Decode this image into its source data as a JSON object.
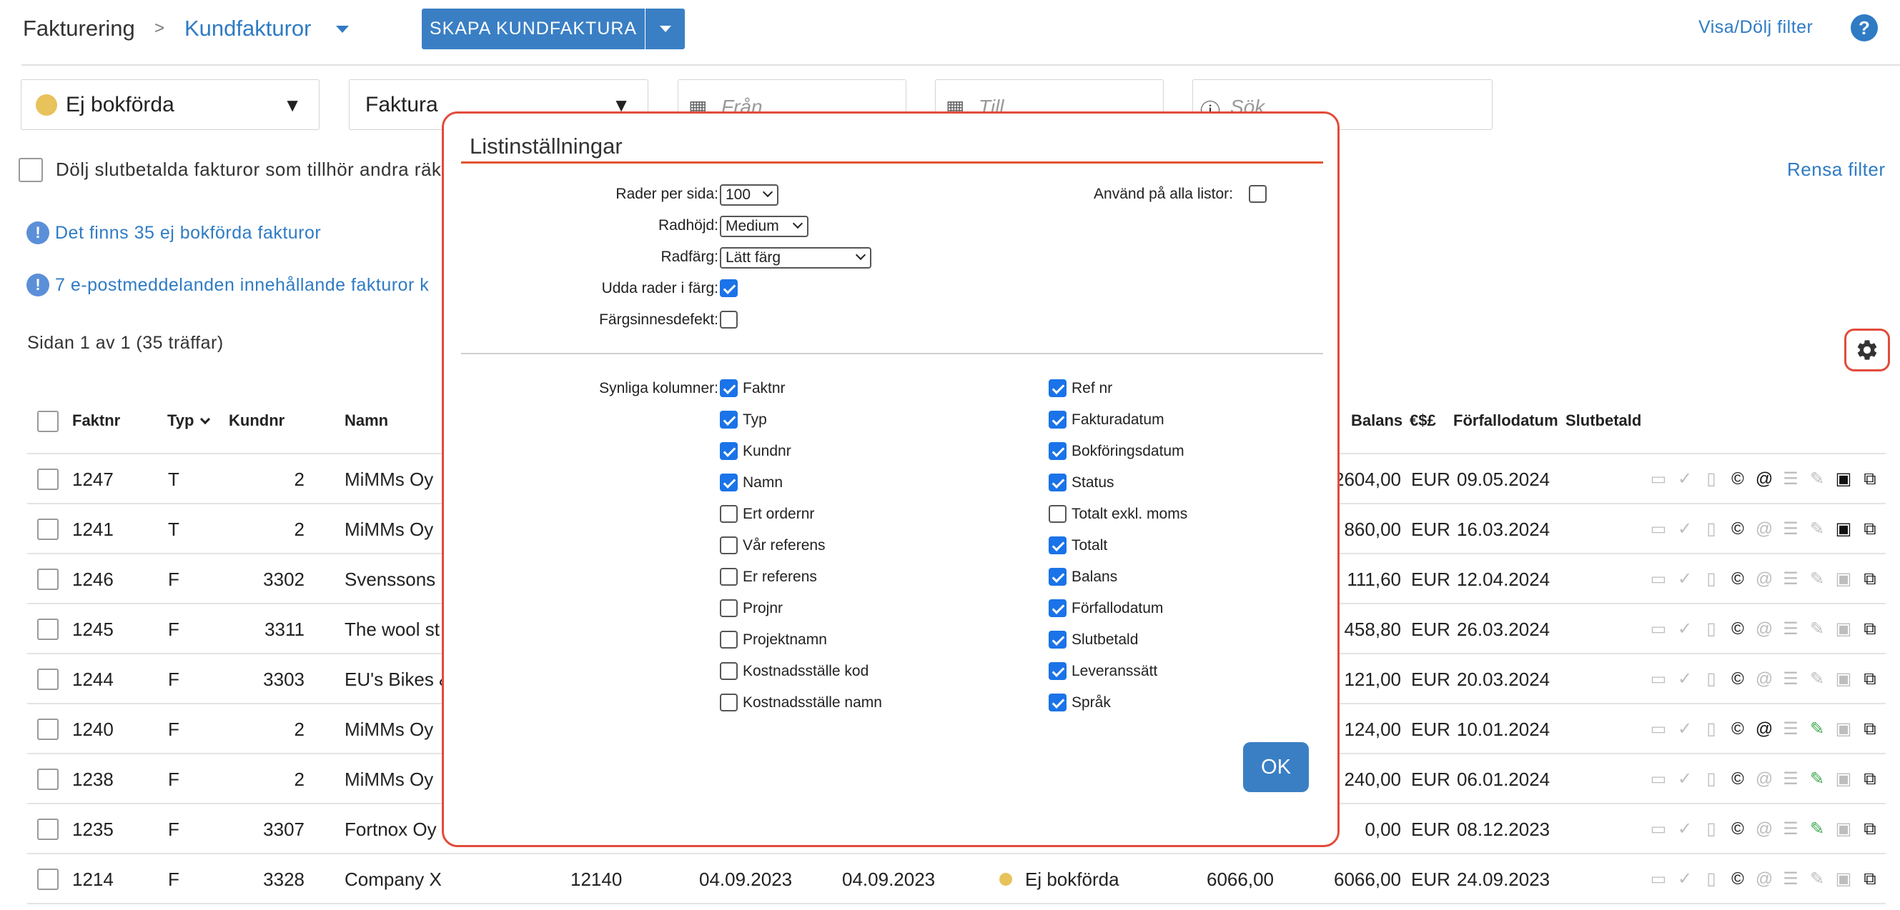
{
  "breadcrumb": {
    "root": "Fakturering",
    "sep": ">",
    "current": "Kundfakturor"
  },
  "toolbar": {
    "create_label": "SKAPA KUNDFAKTURA",
    "toggle_filter": "Visa/Dölj filter",
    "help": "?"
  },
  "filters": {
    "status": "Ej bokförda",
    "type": "Faktura",
    "from_placeholder": "Från",
    "to_placeholder": "Till",
    "search_placeholder": "Sök",
    "hide_paid_label": "Dölj slutbetalda fakturor som tillhör andra räk",
    "clear": "Rensa filter"
  },
  "notices": {
    "unbooked": "Det finns 35 ej bokförda fakturor",
    "emails": "7 e-postmeddelanden innehållande fakturor k"
  },
  "paging": {
    "info": "Sidan 1 av 1  (35 träffar)"
  },
  "table": {
    "headers": {
      "faktnr": "Faktnr",
      "typ": "Typ",
      "kundnr": "Kundnr",
      "namn": "Namn",
      "balans": "Balans",
      "currency": "€$£",
      "forfallodatum": "Förfallodatum",
      "slutbetald": "Slutbetald"
    },
    "rows": [
      {
        "faktnr": "1247",
        "typ": "T",
        "kundnr": "2",
        "namn": "MiMMs Oy",
        "balans": "2604,00",
        "cur": "EUR",
        "due": "09.05.2024"
      },
      {
        "faktnr": "1241",
        "typ": "T",
        "kundnr": "2",
        "namn": "MiMMs Oy",
        "balans": "860,00",
        "cur": "EUR",
        "due": "16.03.2024"
      },
      {
        "faktnr": "1246",
        "typ": "F",
        "kundnr": "3302",
        "namn": "Svenssons",
        "balans": "111,60",
        "cur": "EUR",
        "due": "12.04.2024"
      },
      {
        "faktnr": "1245",
        "typ": "F",
        "kundnr": "3311",
        "namn": "The wool st",
        "balans": "458,80",
        "cur": "EUR",
        "due": "26.03.2024"
      },
      {
        "faktnr": "1244",
        "typ": "F",
        "kundnr": "3303",
        "namn": "EU's Bikes &",
        "balans": "121,00",
        "cur": "EUR",
        "due": "20.03.2024"
      },
      {
        "faktnr": "1240",
        "typ": "F",
        "kundnr": "2",
        "namn": "MiMMs Oy",
        "balans": "124,00",
        "cur": "EUR",
        "due": "10.01.2024"
      },
      {
        "faktnr": "1238",
        "typ": "F",
        "kundnr": "2",
        "namn": "MiMMs Oy",
        "balans": "240,00",
        "cur": "EUR",
        "due": "06.01.2024"
      },
      {
        "faktnr": "1235",
        "typ": "F",
        "kundnr": "3307",
        "namn": "Fortnox Oy",
        "balans": "0,00",
        "cur": "EUR",
        "due": "08.12.2023"
      },
      {
        "faktnr": "1214",
        "typ": "F",
        "kundnr": "3328",
        "namn": "Company X",
        "refnr": "12140",
        "fakturadatum": "04.09.2023",
        "bokforingsdatum": "04.09.2023",
        "status": "Ej bokförda",
        "totalt": "6066,00",
        "balans": "6066,00",
        "cur": "EUR",
        "due": "24.09.2023"
      }
    ]
  },
  "modal": {
    "title": "Listinställningar",
    "rows_per_page_label": "Rader per sida:",
    "rows_per_page_value": "100",
    "row_height_label": "Radhöjd:",
    "row_height_value": "Medium",
    "row_color_label": "Radfärg:",
    "row_color_value": "Lätt färg",
    "odd_rows_label": "Udda rader i färg:",
    "colorblind_label": "Färgsinnesdefekt:",
    "apply_all_label": "Använd på alla listor:",
    "visible_columns_label": "Synliga kolumner:",
    "columns_left": [
      {
        "label": "Faktnr",
        "checked": true
      },
      {
        "label": "Typ",
        "checked": true
      },
      {
        "label": "Kundnr",
        "checked": true
      },
      {
        "label": "Namn",
        "checked": true
      },
      {
        "label": "Ert ordernr",
        "checked": false
      },
      {
        "label": "Vår referens",
        "checked": false
      },
      {
        "label": "Er referens",
        "checked": false
      },
      {
        "label": "Projnr",
        "checked": false
      },
      {
        "label": "Projektnamn",
        "checked": false
      },
      {
        "label": "Kostnadsställe kod",
        "checked": false
      },
      {
        "label": "Kostnadsställe namn",
        "checked": false
      }
    ],
    "columns_right": [
      {
        "label": "Ref nr",
        "checked": true
      },
      {
        "label": "Fakturadatum",
        "checked": true
      },
      {
        "label": "Bokföringsdatum",
        "checked": true
      },
      {
        "label": "Status",
        "checked": true
      },
      {
        "label": "Totalt exkl. moms",
        "checked": false
      },
      {
        "label": "Totalt",
        "checked": true
      },
      {
        "label": "Balans",
        "checked": true
      },
      {
        "label": "Förfallodatum",
        "checked": true
      },
      {
        "label": "Slutbetald",
        "checked": true
      },
      {
        "label": "Leveranssätt",
        "checked": true
      },
      {
        "label": "Språk",
        "checked": true
      }
    ],
    "ok_label": "OK"
  },
  "colors": {
    "accent": "#3a7fc4",
    "highlight": "#e24b3b",
    "status_unbooked": "#e8c25a",
    "checkbox": "#1a73e8"
  }
}
